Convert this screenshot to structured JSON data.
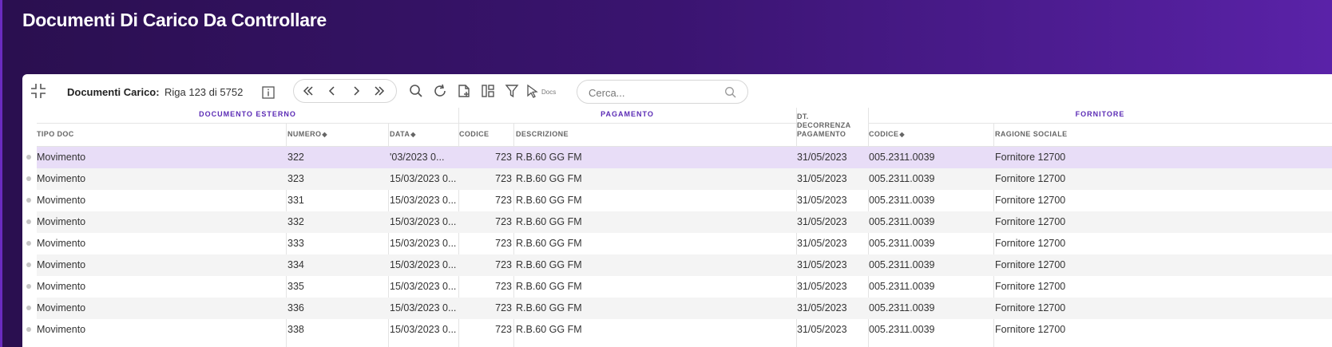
{
  "page_title": "Documenti Di Carico Da Controllare",
  "toolbar": {
    "label": "Documenti Carico:",
    "record_position": "Riga 123 di 5752",
    "docs_label": "Docs",
    "search_placeholder": "Cerca..."
  },
  "groups": {
    "documento_esterno": "DOCUMENTO ESTERNO",
    "pagamento": "PAGAMENTO",
    "fornitore": "FORNITORE"
  },
  "columns": {
    "tipo_doc": "TIPO DOC",
    "numero": "NUMERO",
    "data": "DATA",
    "codice_pag": "CODICE",
    "descrizione": "DESCRIZIONE",
    "dt_decorrenza": [
      "DT.",
      "DECORRENZA",
      "PAGAMENTO"
    ],
    "codice_forn": "CODICE",
    "ragione_sociale": "RAGIONE SOCIALE"
  },
  "rows": [
    {
      "tipo": "Movimento",
      "numero": "322",
      "data": "'03/2023 0...",
      "codice": "723",
      "descrizione": "R.B.60 GG FM",
      "decorrenza": "31/05/2023",
      "codice_forn": "005.2311.0039",
      "ragione": "Fornitore 12700"
    },
    {
      "tipo": "Movimento",
      "numero": "323",
      "data": "15/03/2023 0...",
      "codice": "723",
      "descrizione": "R.B.60 GG FM",
      "decorrenza": "31/05/2023",
      "codice_forn": "005.2311.0039",
      "ragione": "Fornitore 12700"
    },
    {
      "tipo": "Movimento",
      "numero": "331",
      "data": "15/03/2023 0...",
      "codice": "723",
      "descrizione": "R.B.60 GG FM",
      "decorrenza": "31/05/2023",
      "codice_forn": "005.2311.0039",
      "ragione": "Fornitore 12700"
    },
    {
      "tipo": "Movimento",
      "numero": "332",
      "data": "15/03/2023 0...",
      "codice": "723",
      "descrizione": "R.B.60 GG FM",
      "decorrenza": "31/05/2023",
      "codice_forn": "005.2311.0039",
      "ragione": "Fornitore 12700"
    },
    {
      "tipo": "Movimento",
      "numero": "333",
      "data": "15/03/2023 0...",
      "codice": "723",
      "descrizione": "R.B.60 GG FM",
      "decorrenza": "31/05/2023",
      "codice_forn": "005.2311.0039",
      "ragione": "Fornitore 12700"
    },
    {
      "tipo": "Movimento",
      "numero": "334",
      "data": "15/03/2023 0...",
      "codice": "723",
      "descrizione": "R.B.60 GG FM",
      "decorrenza": "31/05/2023",
      "codice_forn": "005.2311.0039",
      "ragione": "Fornitore 12700"
    },
    {
      "tipo": "Movimento",
      "numero": "335",
      "data": "15/03/2023 0...",
      "codice": "723",
      "descrizione": "R.B.60 GG FM",
      "decorrenza": "31/05/2023",
      "codice_forn": "005.2311.0039",
      "ragione": "Fornitore 12700"
    },
    {
      "tipo": "Movimento",
      "numero": "336",
      "data": "15/03/2023 0...",
      "codice": "723",
      "descrizione": "R.B.60 GG FM",
      "decorrenza": "31/05/2023",
      "codice_forn": "005.2311.0039",
      "ragione": "Fornitore 12700"
    },
    {
      "tipo": "Movimento",
      "numero": "338",
      "data": "15/03/2023 0...",
      "codice": "723",
      "descrizione": "R.B.60 GG FM",
      "decorrenza": "31/05/2023",
      "codice_forn": "005.2311.0039",
      "ragione": "Fornitore 12700"
    }
  ],
  "colors": {
    "header_start": "#2a0f4f",
    "header_end": "#5a22a8",
    "accent": "#5b2bb5",
    "selected_row": "#e8ddf7"
  }
}
